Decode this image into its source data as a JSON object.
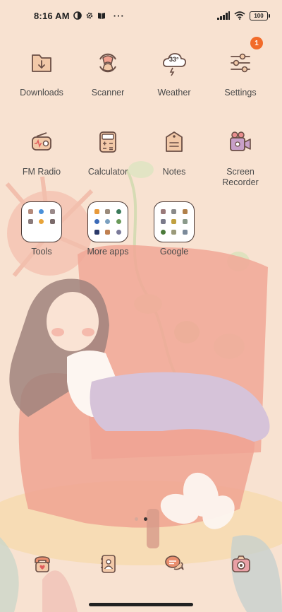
{
  "status_bar": {
    "time": "8:16 AM",
    "more_indicator": "···",
    "battery": "100"
  },
  "apps": [
    {
      "id": "downloads",
      "label": "Downloads",
      "icon": "folder-download-icon"
    },
    {
      "id": "scanner",
      "label": "Scanner",
      "icon": "scanner-icon"
    },
    {
      "id": "weather",
      "label": "Weather",
      "icon": "weather-cloud-icon",
      "icon_text": "33°"
    },
    {
      "id": "settings",
      "label": "Settings",
      "icon": "sliders-settings-icon",
      "badge": "1"
    },
    {
      "id": "fm-radio",
      "label": "FM Radio",
      "icon": "radio-icon"
    },
    {
      "id": "calculator",
      "label": "Calculator",
      "icon": "calculator-icon"
    },
    {
      "id": "notes",
      "label": "Notes",
      "icon": "notes-icon"
    },
    {
      "id": "screen-recorder",
      "label": "Screen\nRecorder",
      "icon": "camera-recorder-icon"
    }
  ],
  "folders": [
    {
      "id": "tools",
      "label": "Tools"
    },
    {
      "id": "more-apps",
      "label": "More apps"
    },
    {
      "id": "google",
      "label": "Google"
    }
  ],
  "page_indicator": {
    "count": 2,
    "active": 1
  },
  "dock": [
    {
      "id": "phone",
      "icon": "phone-icon"
    },
    {
      "id": "contacts",
      "icon": "contacts-icon"
    },
    {
      "id": "messages",
      "icon": "messages-icon"
    },
    {
      "id": "camera",
      "icon": "camera-icon"
    }
  ],
  "colors": {
    "background": "#f8e2d1",
    "icon_fill": "#f2c9a8",
    "icon_stroke": "#6a4e45",
    "badge": "#f26b2a",
    "chair": "#ee8e7e",
    "outfit": "#c8b6dd"
  }
}
